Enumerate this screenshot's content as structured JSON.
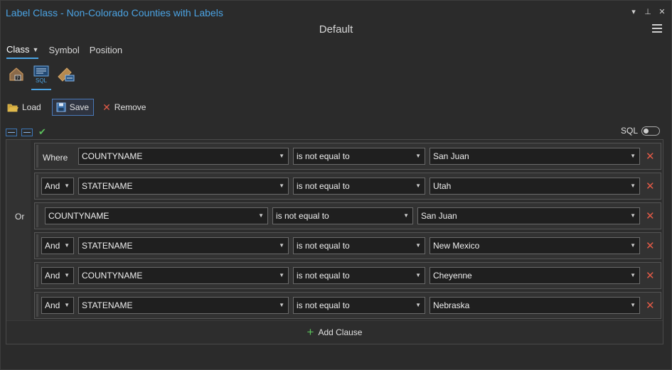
{
  "window": {
    "title": "Label Class - Non-Colorado Counties with Labels",
    "subtitle": "Default",
    "controls": [
      "▾",
      "⊥",
      "✕"
    ]
  },
  "tabs": [
    {
      "label": "Class",
      "active": true
    },
    {
      "label": "Symbol",
      "active": false
    },
    {
      "label": "Position",
      "active": false
    }
  ],
  "modes": {
    "sql_label": "SQL",
    "icons": [
      "label-house-icon",
      "sql-query-icon",
      "label-pencil-icon"
    ]
  },
  "toolbar": {
    "load_label": "Load",
    "save_label": "Save",
    "remove_label": "Remove"
  },
  "sql_toggle": {
    "label": "SQL",
    "on": false
  },
  "or_label": "Or",
  "clauses": [
    {
      "connector": "Where",
      "field": "COUNTYNAME",
      "operator": "is not equal to",
      "value": "San Juan"
    },
    {
      "connector": "And",
      "field": "STATENAME",
      "operator": "is not equal to",
      "value": "Utah"
    },
    {
      "connector": "",
      "field": "COUNTYNAME",
      "operator": "is not equal to",
      "value": "San Juan"
    },
    {
      "connector": "And",
      "field": "STATENAME",
      "operator": "is not equal to",
      "value": "New Mexico"
    },
    {
      "connector": "And",
      "field": "COUNTYNAME",
      "operator": "is not equal to",
      "value": "Cheyenne"
    },
    {
      "connector": "And",
      "field": "STATENAME",
      "operator": "is not equal to",
      "value": "Nebraska"
    }
  ],
  "add_clause_label": "Add Clause",
  "colors": {
    "accent": "#4ba3e3",
    "delete": "#e05a47",
    "success": "#5cc15c"
  }
}
